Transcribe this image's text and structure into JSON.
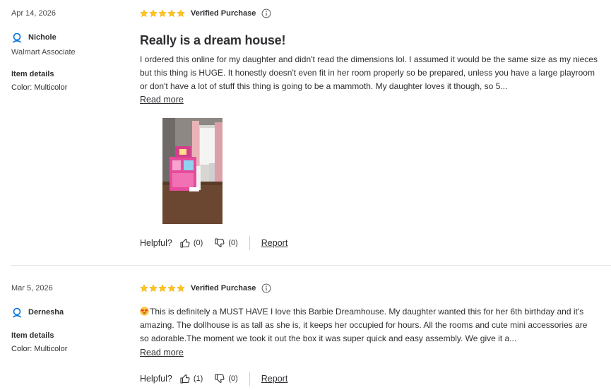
{
  "reviews": [
    {
      "date": "Apr 14, 2026",
      "user": "Nichole",
      "badge": "Walmart Associate",
      "item_details_label": "Item details",
      "item_color": "Color: Multicolor",
      "rating": 5,
      "verified": "Verified Purchase",
      "title": "Really is a dream house!",
      "body": "I ordered this online for my daughter and didn't read the dimensions lol. I assumed it would be the same size as my nieces but this thing is HUGE. It honestly doesn't even fit in her room properly so be prepared, unless you have a large playroom or don't have a lot of stuff this thing is going to be a mammoth. My daughter loves it though, so 5...",
      "read_more": "Read more",
      "helpful_label": "Helpful?",
      "helpful_up": "(0)",
      "helpful_down": "(0)",
      "report": "Report"
    },
    {
      "date": "Mar 5, 2026",
      "user": "Dernesha",
      "item_details_label": "Item details",
      "item_color": "Color: Multicolor",
      "rating": 5,
      "verified": "Verified Purchase",
      "body": "This is definitely a MUST HAVE I love this Barbie Dreamhouse. My daughter wanted this for her 6th birthday and it's amazing. The dollhouse is as tall as she is, it keeps her occupied for hours. All the rooms and cute mini accessories are so adorable.The moment we took it out the box it was super quick and easy assembly. We give it a...",
      "read_more": "Read more",
      "helpful_label": "Helpful?",
      "helpful_up": "(1)",
      "helpful_down": "(0)",
      "report": "Report"
    }
  ],
  "colors": {
    "star": "#ffc220",
    "text": "#2e2f32",
    "divider": "#e3e4e5",
    "accent": "#0071dc"
  },
  "icons": [
    "star-icon",
    "info-icon",
    "user-icon",
    "thumbs-up-icon",
    "thumbs-down-icon",
    "heart-eyes-emoji"
  ]
}
